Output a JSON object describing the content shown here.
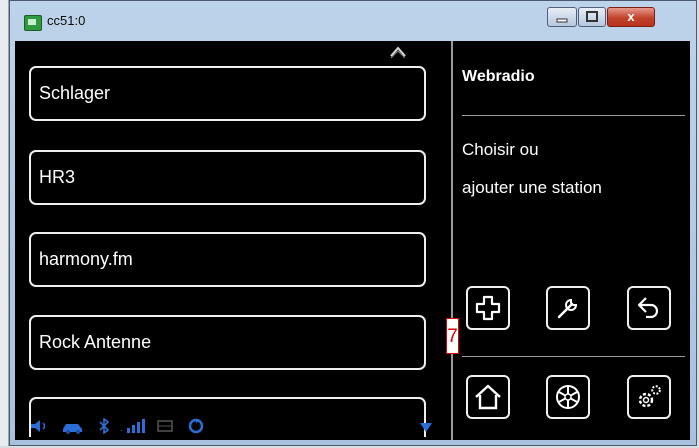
{
  "window": {
    "title": "cc51:0",
    "minimize_icon": "minimize-icon",
    "maximize_icon": "maximize-icon",
    "close_label": "x"
  },
  "station_list": {
    "scroll_up_icon": "chevron-up-icon",
    "items": [
      {
        "label": "Schlager"
      },
      {
        "label": "HR3"
      },
      {
        "label": "harmony.fm"
      },
      {
        "label": "Rock Antenne"
      },
      {
        "label": ""
      }
    ]
  },
  "panel": {
    "title": "Webradio",
    "description_line1": "Choisir ou",
    "description_line2": "ajouter une station",
    "tool_buttons": [
      {
        "icon": "plus-icon"
      },
      {
        "icon": "wrench-icon"
      },
      {
        "icon": "back-icon"
      }
    ],
    "nav_buttons": [
      {
        "icon": "home-icon"
      },
      {
        "icon": "disc-icon"
      },
      {
        "icon": "settings-gear-icon"
      }
    ]
  },
  "status_bar": {
    "icons": [
      "speaker-icon",
      "car-icon",
      "bluetooth-icon",
      "signal-icon",
      "network-icon",
      "sync-icon",
      "dropdown-arrow-icon"
    ]
  },
  "annotation": {
    "marker_label": "7"
  },
  "colors": {
    "background": "#000000",
    "text": "#ffffff",
    "border": "#efefef",
    "status_blue": "#2b6fd6",
    "marker_red": "#e00000"
  }
}
